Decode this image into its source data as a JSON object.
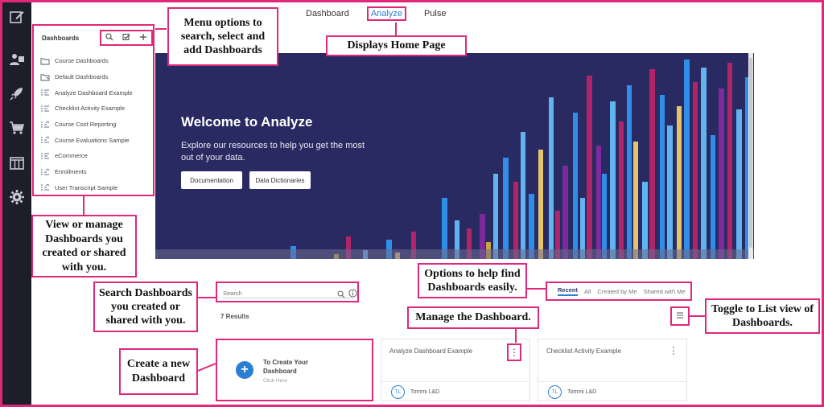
{
  "top_nav": {
    "tabs": [
      "Dashboard",
      "Analyze",
      "Pulse"
    ],
    "active": "Analyze"
  },
  "left_rail": {
    "icons": [
      "edit-icon",
      "users-icon",
      "rocket-icon",
      "cart-icon",
      "columns-icon",
      "gear-icon"
    ]
  },
  "sidebar": {
    "title": "Dashboards",
    "tools": [
      "search-icon",
      "select-icon",
      "add-icon"
    ],
    "items": [
      {
        "label": "Course Dashboards",
        "icon": "folder-icon"
      },
      {
        "label": "Default Dashboards",
        "icon": "shared-folder-icon"
      },
      {
        "label": "Analyze Dashboard Example",
        "icon": "dashboard-icon"
      },
      {
        "label": "Checklist Activity Example",
        "icon": "dashboard-icon"
      },
      {
        "label": "Course Cost Reporting",
        "icon": "shared-dashboard-icon"
      },
      {
        "label": "Course Evaluations Sample",
        "icon": "shared-dashboard-icon"
      },
      {
        "label": "eCommerce",
        "icon": "dashboard-icon"
      },
      {
        "label": "Enrollments",
        "icon": "shared-dashboard-icon"
      },
      {
        "label": "User Transcript Sample",
        "icon": "shared-dashboard-icon"
      }
    ]
  },
  "hero": {
    "title": "Welcome to Analyze",
    "text": "Explore our resources to help you get the most out of your data.",
    "buttons": [
      "Documentation",
      "Data Dictionaries"
    ],
    "bar_colors": [
      "#2f8fe8",
      "#b0256a",
      "#c9a640",
      "#62b4f0",
      "#7d2a9c",
      "#e3c46a"
    ]
  },
  "search": {
    "placeholder": "Search"
  },
  "results_text": "7 Results",
  "filter_tabs": {
    "tabs": [
      "Recent",
      "All",
      "Created by Me",
      "Shared with Me"
    ],
    "active": "Recent"
  },
  "create_card": {
    "title": "To Create Your Dashboard",
    "subtitle": "Click Here"
  },
  "cards": [
    {
      "title": "Analyze Dashboard Example",
      "initials": "TL",
      "owner": "Tommi L&D"
    },
    {
      "title": "Checklist Activity Example",
      "initials": "TL",
      "owner": "Tommi L&D"
    }
  ],
  "callouts": {
    "menu": "Menu options to search, select and add Dashboards",
    "home": "Displays Home Page",
    "manage_list": "View or manage Dashboards you created or shared with you.",
    "search": "Search Dashboards you created or shared with you.",
    "filters": "Options to help find Dashboards easily.",
    "manage_card": "Manage the Dashboard.",
    "toggle": "Toggle to List view of Dashboards.",
    "create": "Create a new Dashboard"
  },
  "colors": {
    "accent": "#e0287a",
    "brand_blue": "#2a7fd4",
    "hero_bg": "#2a2a63",
    "rail_bg": "#1e1e2a"
  }
}
